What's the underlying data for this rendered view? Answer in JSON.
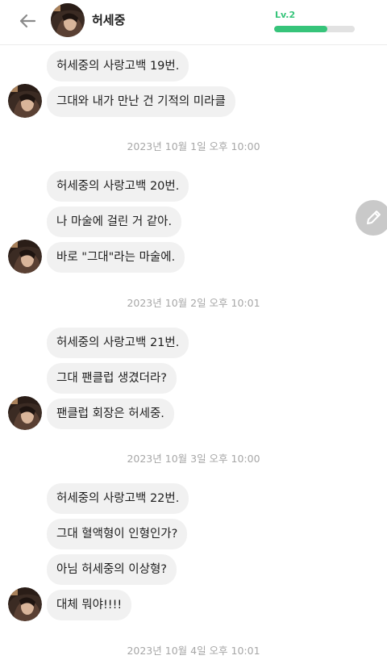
{
  "header": {
    "name": "허세중",
    "level_label": "Lv.2",
    "level_progress": 0.66,
    "back_icon": "arrow-left-icon",
    "accent_color": "#36c47a"
  },
  "fab": {
    "icon": "pencil-icon"
  },
  "messages": [
    {
      "text": "허세중의 사랑고백 19번."
    },
    {
      "text": "그대와 내가 만난 건 기적의 미라클"
    },
    {
      "text": "2023년 10월 1일 오후 10:00"
    },
    {
      "text": "허세중의 사랑고백 20번."
    },
    {
      "text": "나 마술에 걸린 거 같아."
    },
    {
      "text": "바로 \"그대\"라는 마술에."
    },
    {
      "text": "2023년 10월 2일 오후 10:01"
    },
    {
      "text": "허세중의 사랑고백 21번."
    },
    {
      "text": "그대 팬클럽 생겼더라?"
    },
    {
      "text": "팬클럽 회장은 허세중."
    },
    {
      "text": "2023년 10월 3일 오후 10:00"
    },
    {
      "text": "허세중의 사랑고백 22번."
    },
    {
      "text": "그대 혈액형이 인형인가?"
    },
    {
      "text": "아님 허세중의 이상형?"
    },
    {
      "text": "대체 뭐야!!!!"
    },
    {
      "text": "2023년 10월 4일 오후 10:01"
    }
  ]
}
